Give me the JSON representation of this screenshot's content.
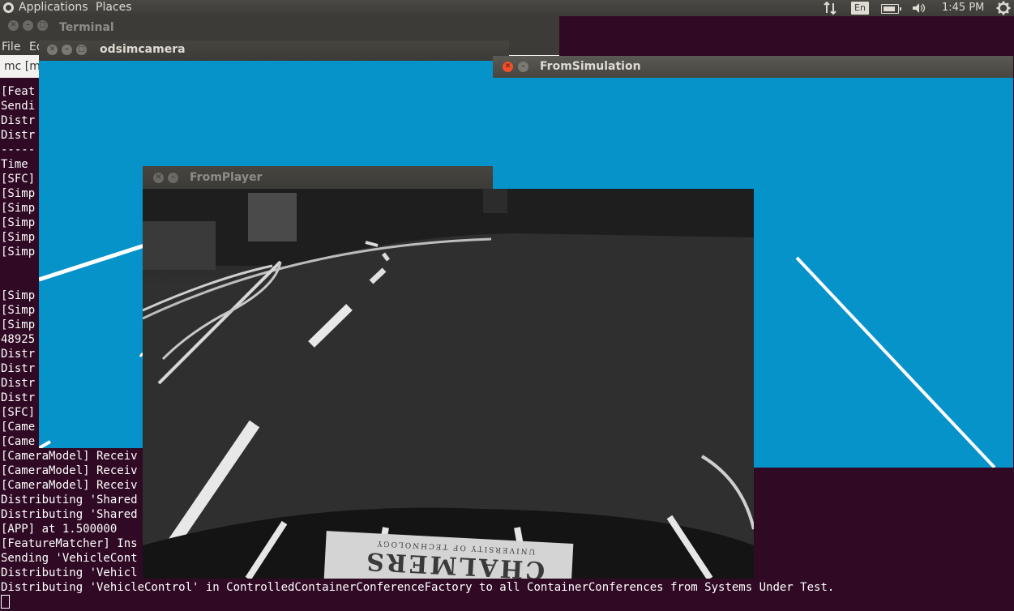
{
  "top_panel": {
    "menus": [
      "Applications",
      "Places"
    ],
    "keyboard": "En",
    "battery_level": 0.85,
    "clock": "1:45 PM"
  },
  "terminal": {
    "title": "Terminal",
    "menu": [
      "File",
      "Ed"
    ],
    "tab_label": "mc [m",
    "lines": [
      "[Feat",
      "Sendi",
      "Distr",
      "Distr",
      "-----",
      "Time",
      "[SFC]",
      "[Simp",
      "[Simp",
      "[Simp",
      "[Simp",
      "[Simp",
      "",
      "",
      "[Simp",
      "[Simp",
      "[Simp",
      "48925",
      "Distr",
      "Distr",
      "Distr",
      "Distr",
      "[SFC]",
      "[Came",
      "[Came",
      "[CameraModel] Receiv",
      "[CameraModel] Receiv",
      "[CameraModel] Receiv",
      "Distributing 'Shared                                                      tems Under Test.",
      "Distributing 'Shared",
      "[APP] at 1.500000",
      "[FeatureMatcher] Ins",
      "Sending 'VehicleCont",
      "Distributing 'Vehicl",
      "Distributing 'VehicleControl' in ControlledContainerConferenceFactory to all ContainerConferences from Systems Under Test."
    ]
  },
  "odsim": {
    "title": "odsimcamera"
  },
  "fromsim": {
    "title": "FromSimulation"
  },
  "fromplayer": {
    "title": "FromPlayer",
    "logo_text": "CHALMERS",
    "logo_sub": "UNIVERSITY OF TECHNOLOGY"
  },
  "colors": {
    "sim_background": "#0693c9",
    "terminal_bg": "#300a24",
    "panel": "#3c3b37",
    "close_red": "#ef4f2a"
  }
}
